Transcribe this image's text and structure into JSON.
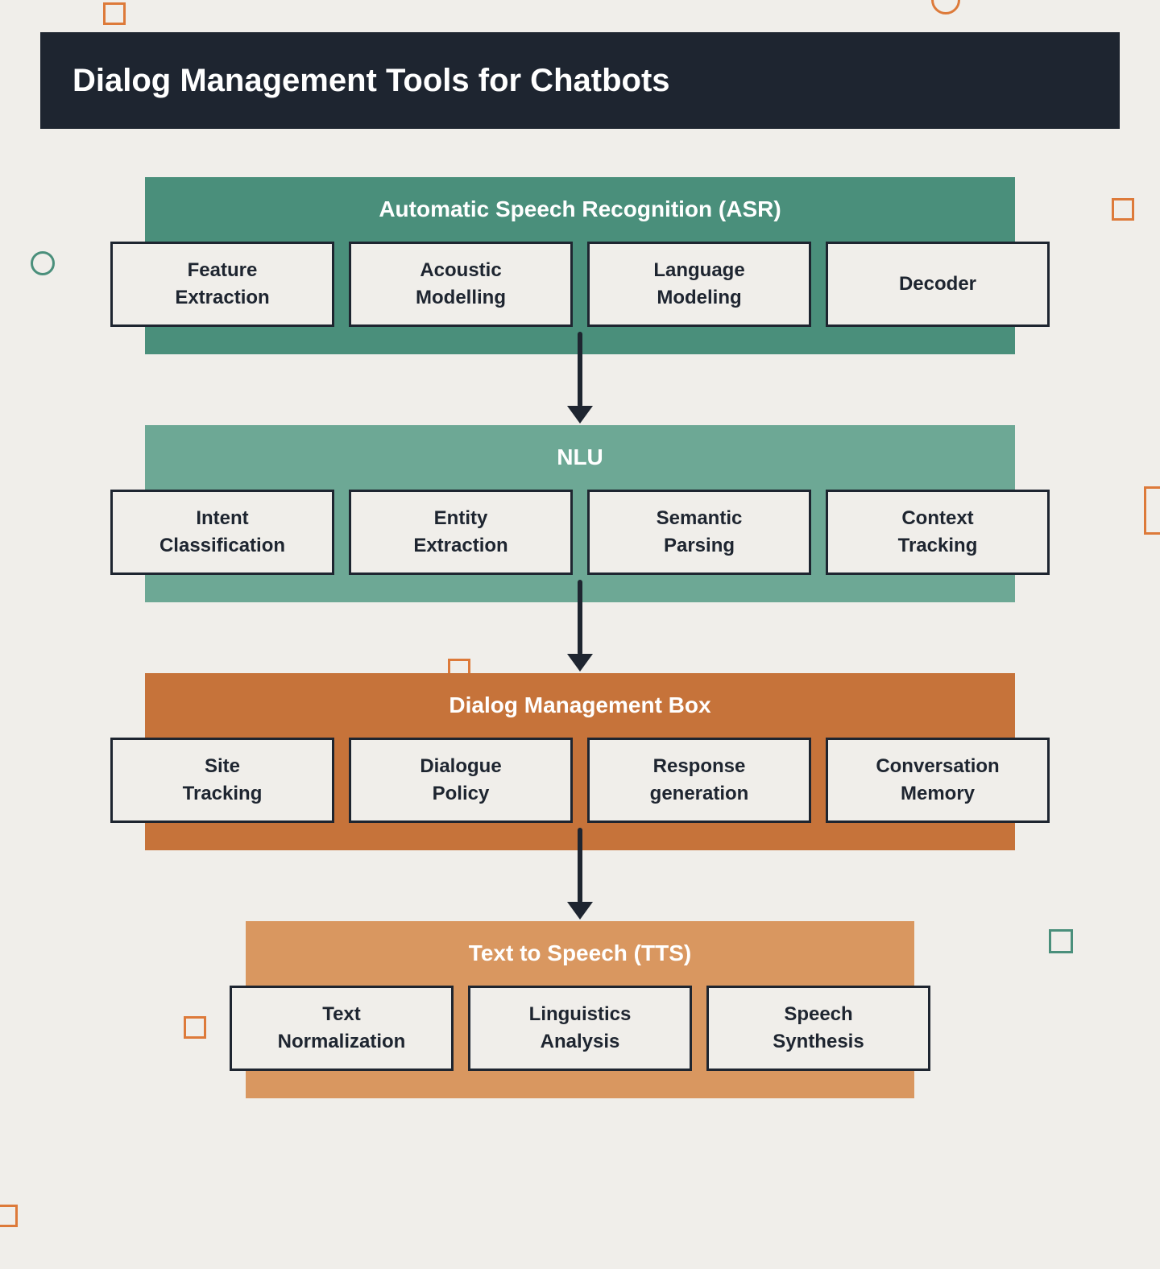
{
  "header": {
    "title": "Dialog Management Tools for Chatbots"
  },
  "sections": [
    {
      "title": "Automatic Speech Recognition (ASR)",
      "items": [
        {
          "line1": "Feature",
          "line2": "Extraction"
        },
        {
          "line1": "Acoustic",
          "line2": "Modelling"
        },
        {
          "line1": "Language",
          "line2": "Modeling"
        },
        {
          "line1": "Decoder",
          "line2": ""
        }
      ]
    },
    {
      "title": "NLU",
      "items": [
        {
          "line1": "Intent",
          "line2": "Classification"
        },
        {
          "line1": "Entity",
          "line2": "Extraction"
        },
        {
          "line1": "Semantic",
          "line2": "Parsing"
        },
        {
          "line1": "Context",
          "line2": "Tracking"
        }
      ]
    },
    {
      "title": "Dialog Management Box",
      "items": [
        {
          "line1": "Site",
          "line2": "Tracking"
        },
        {
          "line1": "Dialogue",
          "line2": "Policy"
        },
        {
          "line1": "Response",
          "line2": "generation"
        },
        {
          "line1": "Conversation",
          "line2": "Memory"
        }
      ]
    },
    {
      "title": "Text to Speech (TTS)",
      "items": [
        {
          "line1": "Text",
          "line2": "Normalization"
        },
        {
          "line1": "Linguistics",
          "line2": "Analysis"
        },
        {
          "line1": "Speech",
          "line2": "Synthesis"
        }
      ]
    }
  ],
  "colors": {
    "orange": "#dd7a3a",
    "green": "#4a8f7b"
  }
}
